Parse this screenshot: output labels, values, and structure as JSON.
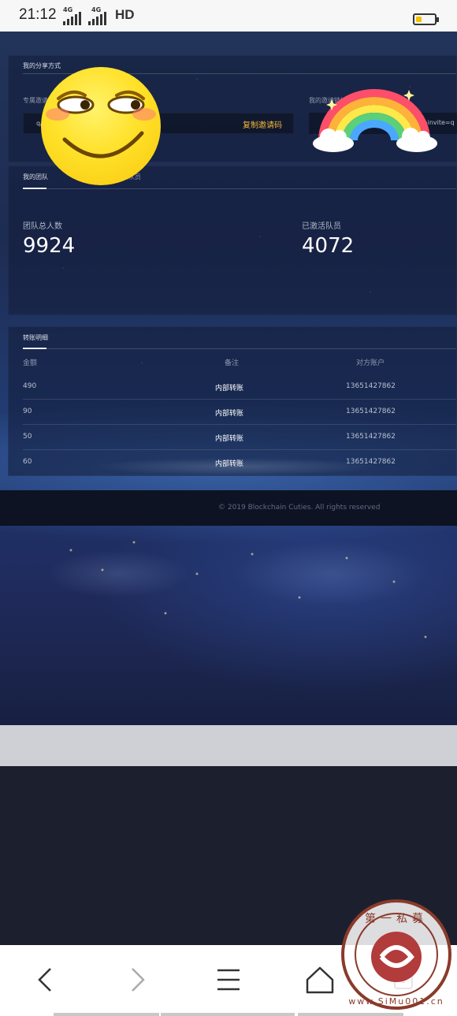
{
  "status_bar": {
    "time": "21:12",
    "network_1": "4G",
    "network_2": "4G",
    "hd": "HD",
    "battery_color": "#f2c200"
  },
  "share": {
    "title": "我的分享方式",
    "invite_code_label": "专属邀请码",
    "invite_code_value": "q/",
    "copy_button": "复制邀请码",
    "invite_link_label": "我的邀请链接",
    "invite_link_value": "/c=index&a=register&invite=q"
  },
  "team": {
    "tabs": [
      "我的团队",
      "已激活队员"
    ],
    "total_label": "团队总人数",
    "total_value": "9924",
    "active_label": "已激活队员",
    "active_value": "4072"
  },
  "transfers": {
    "tab": "转账明细",
    "columns": [
      "金额",
      "备注",
      "对方账户"
    ],
    "rows": [
      {
        "amount": "490",
        "memo": "内部转账",
        "account": "13651427862"
      },
      {
        "amount": "90",
        "memo": "内部转账",
        "account": "13651427862"
      },
      {
        "amount": "50",
        "memo": "内部转账",
        "account": "13651427862"
      },
      {
        "amount": "60",
        "memo": "内部转账",
        "account": "13651427862"
      }
    ]
  },
  "footer": {
    "copyright": "© 2019 Blockchain Cuties. All rights reserved"
  },
  "browser_nav": {
    "icons": [
      "back-arrow-icon",
      "forward-arrow-icon",
      "menu-icon",
      "home-icon",
      "tabs-icon"
    ],
    "tab_count": "1"
  },
  "watermark": {
    "text": "www.SiMu001.cn",
    "chars": "第一私募"
  },
  "colors": {
    "accent": "#f3b63a",
    "panel": "#121c38"
  }
}
